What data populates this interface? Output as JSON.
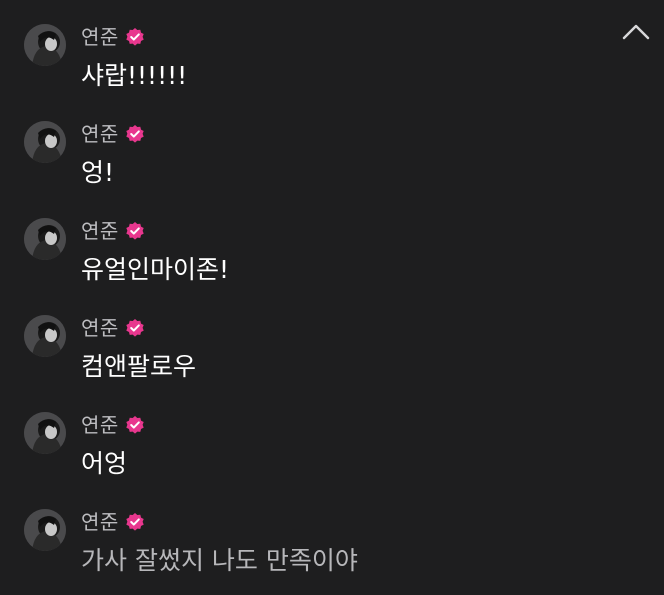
{
  "colors": {
    "background": "#1e1e1f",
    "name": "#bdbdc0",
    "text": "#ffffff",
    "text_dim": "#b7b7ba",
    "badge": "#e8378e"
  },
  "icons": {
    "collapse": "chevron-up-icon",
    "verified": "verified-badge-icon"
  },
  "messages": [
    {
      "author": "연준",
      "text": "샤랍!!!!!!"
    },
    {
      "author": "연준",
      "text": "엉!"
    },
    {
      "author": "연준",
      "text": "유얼인마이존!"
    },
    {
      "author": "연준",
      "text": "컴앤팔로우"
    },
    {
      "author": "연준",
      "text": "어엉"
    },
    {
      "author": "연준",
      "text": "가사 잘썼지 나도 만족이야"
    }
  ]
}
